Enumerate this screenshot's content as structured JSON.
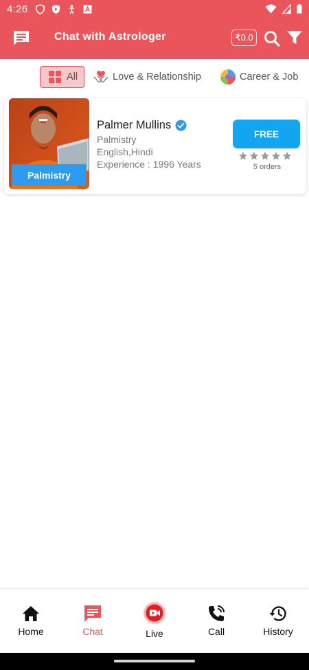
{
  "status_bar": {
    "time": "4:26",
    "icons": [
      "shield-icon",
      "shield-play-icon",
      "accessibility-icon",
      "font-icon"
    ],
    "right_icons": [
      "wifi-icon",
      "signal-icon",
      "battery-icon"
    ]
  },
  "header": {
    "title": "Chat with Astrologer",
    "wallet_balance": "₹0.0",
    "icons": [
      "chat-icon",
      "search-icon",
      "filter-icon"
    ],
    "bg_color": "#e9555a"
  },
  "categories": [
    {
      "label": "All",
      "icon": "grid-icon",
      "selected": true
    },
    {
      "label": "Love & Relationship",
      "icon": "heart-hands-icon",
      "selected": false
    },
    {
      "label": "Career & Job",
      "icon": "career-icon",
      "selected": false
    }
  ],
  "astrologers": [
    {
      "name": "Palmer Mullins",
      "verified": true,
      "skill_tag": "Palmistry",
      "specialty": "Palmistry",
      "languages": "English,Hindi",
      "experience": "Experience : 1996 Years",
      "cta_label": "FREE",
      "rating": 0,
      "orders": "5 orders"
    }
  ],
  "bottom_nav": [
    {
      "label": "Home",
      "icon": "home-icon",
      "active": false
    },
    {
      "label": "Chat",
      "icon": "chat-icon",
      "active": true
    },
    {
      "label": "Live",
      "icon": "live-icon",
      "active": false
    },
    {
      "label": "Call",
      "icon": "phone-icon",
      "active": false
    },
    {
      "label": "History",
      "icon": "history-icon",
      "active": false
    }
  ],
  "colors": {
    "accent": "#e9555a",
    "cta": "#13a6ee",
    "tag": "#2d9cf0"
  }
}
